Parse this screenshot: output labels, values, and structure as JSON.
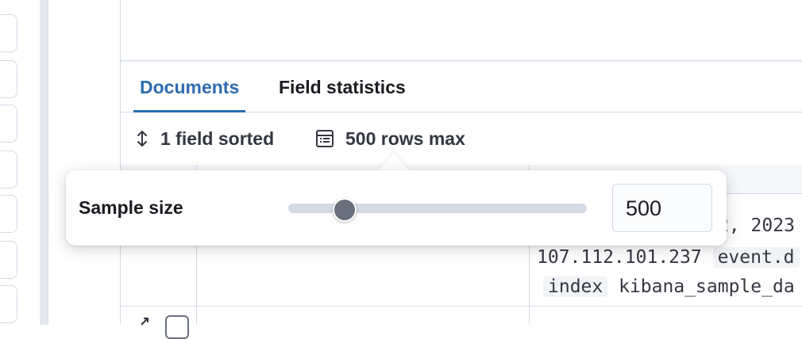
{
  "tabs": {
    "documents": "Documents",
    "field_statistics": "Field statistics"
  },
  "toolbar": {
    "sort_label": "1 field sorted",
    "rows_label": "500 rows max"
  },
  "popover": {
    "label": "Sample size",
    "value": "500",
    "slider_fraction": 0.19
  },
  "grid": {
    "row1_suffix": "2, 2023",
    "row2_ip": "107.112.101.237",
    "row2_chip": "event.d",
    "row3_chip": "index",
    "row3_text": "kibana_sample_da"
  },
  "colors": {
    "accent": "#2d6cb0",
    "slider_thumb": "#69707d"
  },
  "icons": [
    "sort-icon",
    "table-rows-icon",
    "expand-icon"
  ]
}
